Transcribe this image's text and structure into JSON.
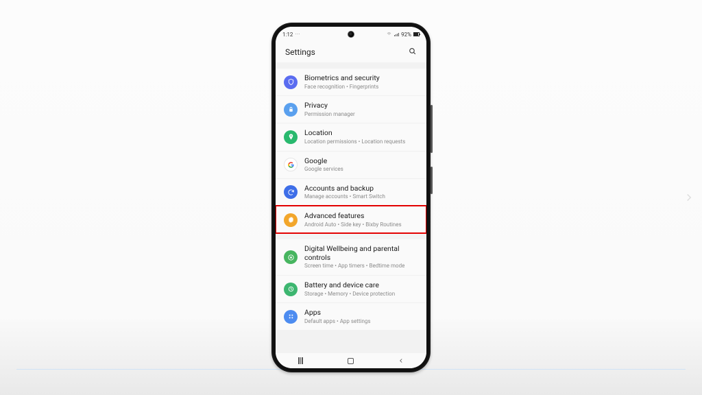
{
  "status": {
    "time": "1:12",
    "battery_pct": "92%"
  },
  "header": {
    "title": "Settings"
  },
  "rows": {
    "bio": {
      "title": "Biometrics and security",
      "sub": "Face recognition  •  Fingerprints"
    },
    "priv": {
      "title": "Privacy",
      "sub": "Permission manager"
    },
    "loc": {
      "title": "Location",
      "sub": "Location permissions  •  Location requests"
    },
    "goog": {
      "title": "Google",
      "sub": "Google services"
    },
    "acct": {
      "title": "Accounts and backup",
      "sub": "Manage accounts  •  Smart Switch"
    },
    "adv": {
      "title": "Advanced features",
      "sub": "Android Auto  •  Side key  •  Bixby Routines"
    },
    "dig": {
      "title": "Digital Wellbeing and parental controls",
      "sub": "Screen time  •  App timers  •  Bedtime mode"
    },
    "bat": {
      "title": "Battery and device care",
      "sub": "Storage  •  Memory  •  Device protection"
    },
    "apps": {
      "title": "Apps",
      "sub": "Default apps  •  App settings"
    }
  }
}
